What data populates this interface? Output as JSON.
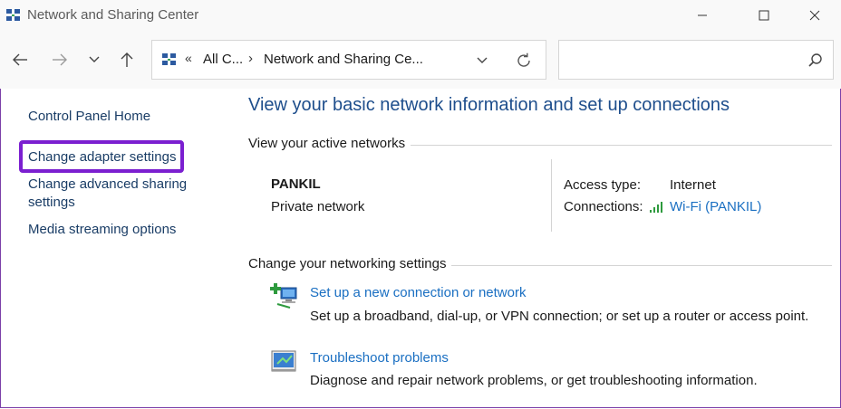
{
  "window": {
    "title": "Network and Sharing Center"
  },
  "address_bar": {
    "overflow_glyph": "«",
    "crumbs": [
      "All C...",
      "Network and Sharing Ce..."
    ],
    "separator": "›"
  },
  "search": {
    "placeholder": ""
  },
  "sidebar": {
    "items": [
      {
        "label": "Control Panel Home"
      },
      {
        "label": "Change adapter settings"
      },
      {
        "label": "Change advanced sharing"
      },
      {
        "label": "settings"
      },
      {
        "label": "Media streaming options"
      }
    ]
  },
  "main": {
    "title": "View your basic network information and set up connections",
    "active_networks": {
      "heading": "View your active networks",
      "network_name": "PANKIL",
      "network_type": "Private network",
      "access_type_label": "Access type:",
      "access_type_value": "Internet",
      "connections_label": "Connections:",
      "connection_link": "Wi-Fi (PANKIL)"
    },
    "settings": {
      "heading": "Change your networking settings",
      "tasks": [
        {
          "icon": "new-connection-icon",
          "link": "Set up a new connection or network",
          "desc": "Set up a broadband, dial-up, or VPN connection; or set up a router or access point."
        },
        {
          "icon": "troubleshoot-icon",
          "link": "Troubleshoot problems",
          "desc": "Diagnose and repair network problems, or get troubleshooting information."
        }
      ]
    }
  },
  "colors": {
    "accent_link": "#1a6fc2",
    "title_blue": "#1e4e8c",
    "highlight_purple": "#7b1fd0"
  }
}
